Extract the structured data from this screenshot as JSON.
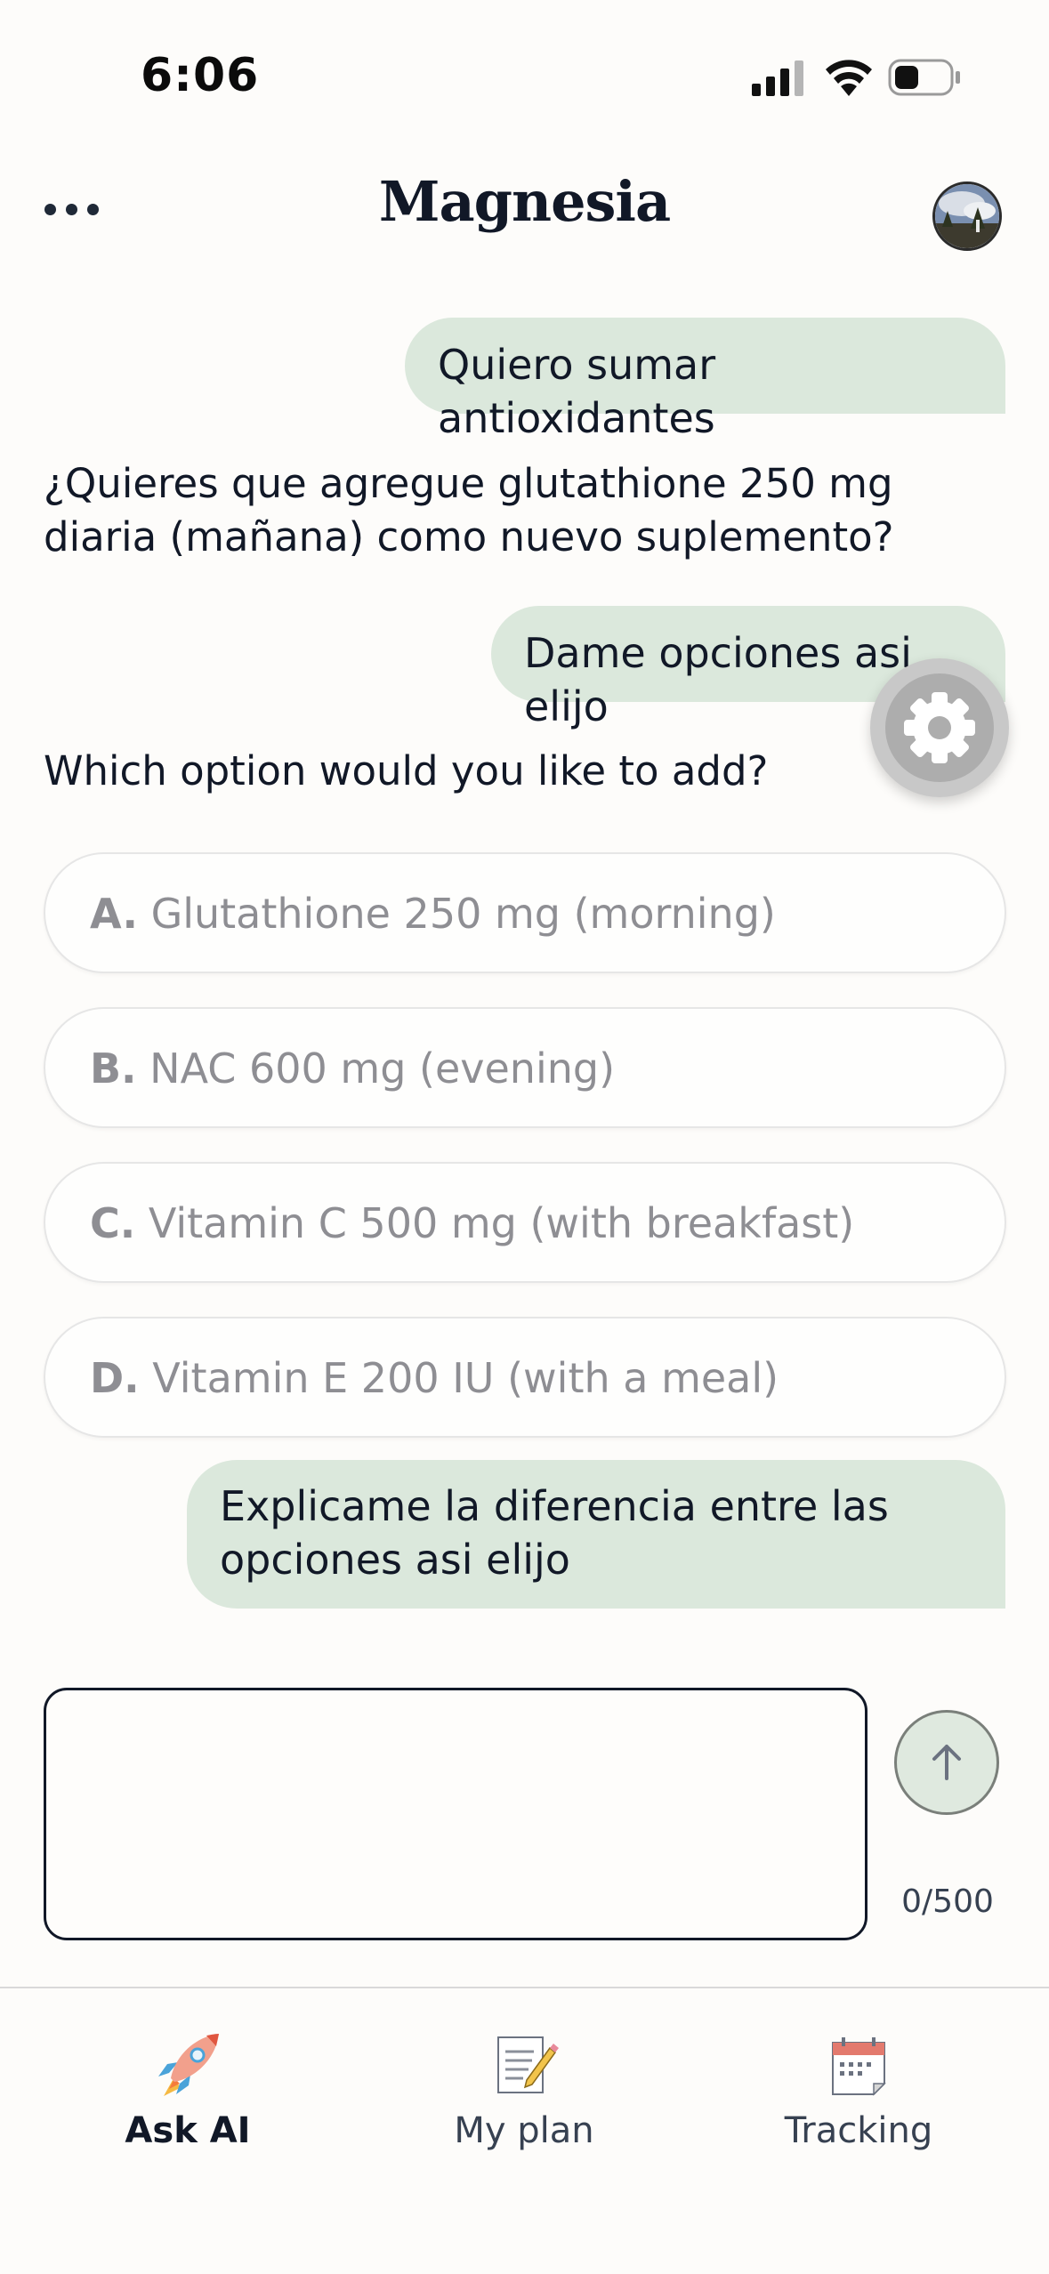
{
  "status_bar": {
    "time": "6:06"
  },
  "header": {
    "title": "Magnesia"
  },
  "chat": {
    "messages": [
      {
        "role": "user",
        "text": "Quiero sumar antioxidantes"
      },
      {
        "role": "assistant",
        "text": "¿Quieres que agregue glutathione 250 mg diaria (mañana) como nuevo suplemento?"
      },
      {
        "role": "user",
        "text": "Dame opciones asi elijo"
      },
      {
        "role": "assistant",
        "text": "Which option would you like to add?"
      },
      {
        "role": "user",
        "text": "Explicame la diferencia entre las opciones asi elijo"
      }
    ],
    "options": [
      {
        "letter": "A.",
        "text": "Glutathione 250 mg (morning)"
      },
      {
        "letter": "B.",
        "text": "NAC 600 mg (evening)"
      },
      {
        "letter": "C.",
        "text": "Vitamin C 500 mg (with breakfast)"
      },
      {
        "letter": "D.",
        "text": "Vitamin E 200 IU (with a meal)"
      }
    ]
  },
  "input": {
    "value": "",
    "char_count": "0/500"
  },
  "nav": {
    "items": [
      {
        "label": "Ask AI",
        "icon": "rocket-icon",
        "active": true
      },
      {
        "label": "My plan",
        "icon": "notepad-icon",
        "active": false
      },
      {
        "label": "Tracking",
        "icon": "calendar-icon",
        "active": false
      }
    ]
  },
  "colors": {
    "user_bubble": "#dbe8dc",
    "text": "#111827",
    "option_text": "#8e8e93",
    "send_button": "#dfe9df"
  }
}
